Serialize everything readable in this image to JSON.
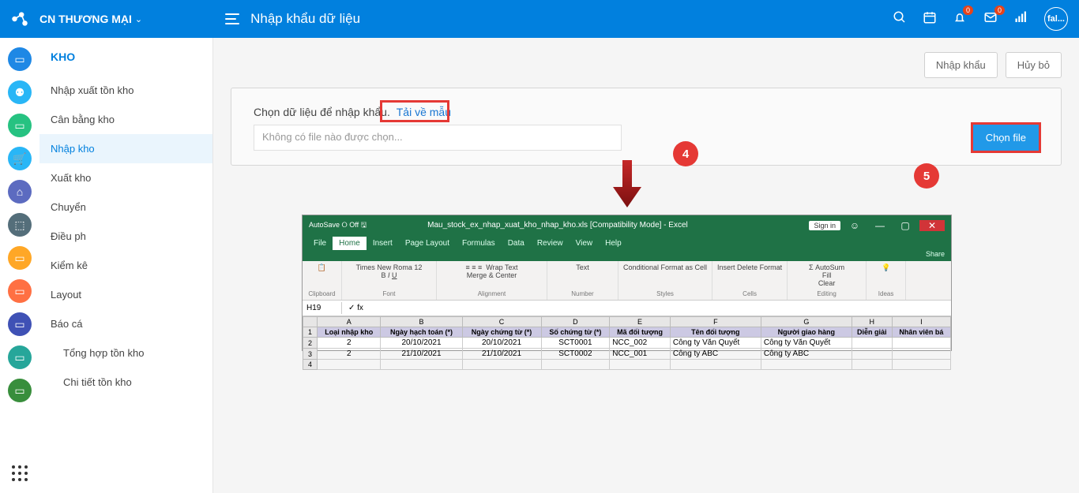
{
  "header": {
    "company": "CN THƯƠNG MẠI",
    "breadcrumb": "Nhập khẩu dữ liệu",
    "bell_badge": "0",
    "mail_badge": "0",
    "avatar": "fal..."
  },
  "icon_rail": [
    {
      "color": "#1e88e5"
    },
    {
      "color": "#29b6f6"
    },
    {
      "color": "#26c281"
    },
    {
      "color": "#29b6f6"
    },
    {
      "color": "#5c6bc0"
    },
    {
      "color": "#546e7a"
    },
    {
      "color": "#ffa726"
    },
    {
      "color": "#ff7043"
    },
    {
      "color": "#3f51b5"
    },
    {
      "color": "#26a69a"
    },
    {
      "color": "#388e3c"
    }
  ],
  "sidebar": {
    "title": "KHO",
    "items": [
      {
        "label": "Nhập xuất tồn kho"
      },
      {
        "label": "Cân bằng kho"
      },
      {
        "label": "Nhập kho",
        "active": true
      },
      {
        "label": "Xuất kho"
      },
      {
        "label": "Chuyển"
      },
      {
        "label": "Điều ph"
      },
      {
        "label": "Kiểm kê"
      },
      {
        "label": "Layout"
      },
      {
        "label": "Báo cá"
      },
      {
        "label": "Tổng hợp tồn kho",
        "sub": true
      },
      {
        "label": "Chi tiết tồn kho",
        "sub": true
      }
    ]
  },
  "actions": {
    "import": "Nhập khẩu",
    "cancel": "Hủy bỏ"
  },
  "card": {
    "prompt_text": "Chọn dữ liệu để nhập khẩu.",
    "download_tmpl": "Tải về mẫu",
    "file_input_placeholder": "Không có file nào được chọn...",
    "choose_file": "Chọn file"
  },
  "callouts": {
    "n4": "4",
    "n5": "5"
  },
  "excel": {
    "filename": "Mau_stock_ex_nhap_xuat_kho_nhap_kho.xls  [Compatibility Mode]  -  Excel",
    "signin": "Sign in",
    "tabs": [
      "File",
      "Home",
      "Insert",
      "Page Layout",
      "Formulas",
      "Data",
      "Review",
      "View",
      "Help"
    ],
    "ribbon_groups": [
      "Clipboard",
      "Font",
      "Alignment",
      "Number",
      "Styles",
      "Cells",
      "Editing",
      "Ideas"
    ],
    "font_name": "Times New Roma",
    "font_size": "12",
    "wrap": "Wrap Text",
    "merge": "Merge & Center",
    "num_fmt": "Text",
    "autosum": "AutoSum",
    "fill": "Fill",
    "clear": "Clear",
    "share": "Share",
    "cell": "H19",
    "columns_letters": [
      "",
      "A",
      "B",
      "C",
      "D",
      "E",
      "F",
      "G",
      "H",
      "I"
    ],
    "headers": [
      "Loại nhập kho",
      "Ngày hạch toán (*)",
      "Ngày chứng từ (*)",
      "Số chứng từ (*)",
      "Mã đối tượng",
      "Tên đối tượng",
      "Người giao hàng",
      "Diễn giải",
      "Nhân viên bá"
    ],
    "rows": [
      [
        "2",
        "2",
        "20/10/2021",
        "20/10/2021",
        "SCT0001",
        "NCC_002",
        "Công ty Văn Quyết",
        "Công ty Văn Quyết",
        "",
        ""
      ],
      [
        "3",
        "2",
        "21/10/2021",
        "21/10/2021",
        "SCT0002",
        "NCC_001",
        "Công ty ABC",
        "Công ty ABC",
        "",
        ""
      ],
      [
        "4",
        "",
        "",
        "",
        "",
        "",
        "",
        "",
        "",
        ""
      ]
    ]
  }
}
